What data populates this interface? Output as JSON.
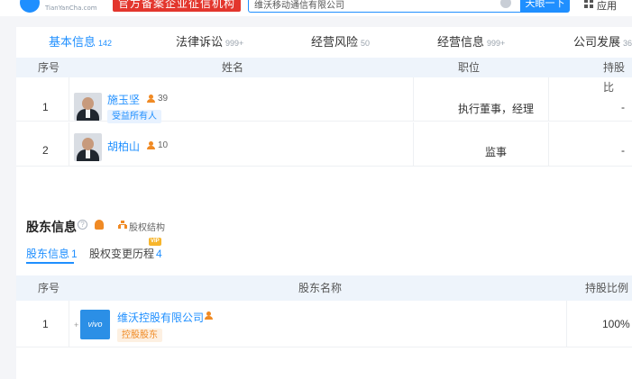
{
  "header": {
    "logo_sub": "TianYanCha.com",
    "badge": "官方备案企业征信机构",
    "search_value": "维沃移动通信有限公司",
    "search_button": "天眼一下",
    "apps_label": "应用"
  },
  "tabs": [
    {
      "label": "基本信息",
      "count": "142"
    },
    {
      "label": "法律诉讼",
      "count": "999+"
    },
    {
      "label": "经营风险",
      "count": "50"
    },
    {
      "label": "经营信息",
      "count": "999+"
    },
    {
      "label": "公司发展",
      "count": "36"
    }
  ],
  "members_table": {
    "headers": [
      "序号",
      "姓名",
      "职位",
      "持股比"
    ],
    "rows": [
      {
        "index": "1",
        "name": "施玉坚",
        "count": "39",
        "tag": "受益所有人",
        "role": "执行董事，经理",
        "share": "-"
      },
      {
        "index": "2",
        "name": "胡柏山",
        "count": "10",
        "tag": "",
        "role": "监事",
        "share": "-"
      }
    ]
  },
  "shareholders": {
    "title": "股东信息",
    "help_glyph": "?",
    "structure_link": "股权结构",
    "subtabs": [
      {
        "label": "股东信息",
        "count": "1"
      },
      {
        "label": "股权变更历程",
        "count": "4"
      }
    ],
    "vip_badge": "VIP",
    "headers": [
      "序号",
      "股东名称",
      "持股比例"
    ],
    "rows": [
      {
        "index": "1",
        "plus": "+",
        "logo_text": "vivo",
        "name": "维沃控股有限公司",
        "tag": "控股股东",
        "ratio": "100%"
      }
    ]
  },
  "colors": {
    "accent": "#1f8fff",
    "brand_red": "#e3362d",
    "tag_orange": "#f08a24"
  }
}
